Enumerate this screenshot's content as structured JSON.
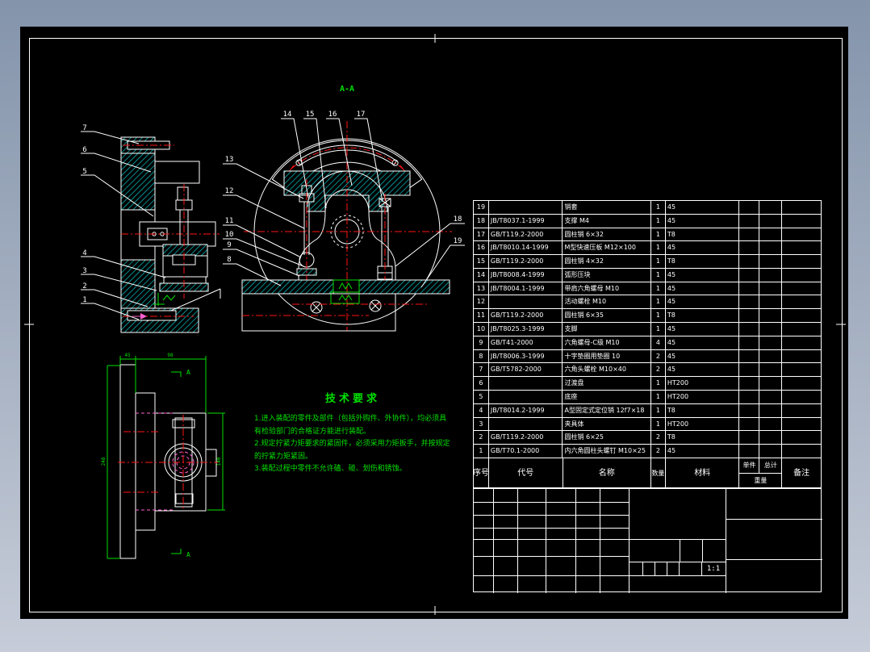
{
  "colors": {
    "background_top": "#8494ab",
    "background_bottom": "#c6ccd8",
    "canvas": "#000000",
    "line": "#ffffff",
    "hatch": "#00e6e6",
    "centerline": "#ff1414",
    "annotation": "#00e000",
    "hidden_line": "#ff5fd0"
  },
  "section_view": {
    "title": "A-A",
    "labels_top": [
      "14",
      "15",
      "16",
      "17"
    ],
    "labels_left": [
      "13",
      "12",
      "11",
      "10",
      "9",
      "8"
    ],
    "labels_right": [
      "18",
      "19"
    ]
  },
  "side_view": {
    "labels_upper": [
      "7",
      "6",
      "5"
    ],
    "labels_lower": [
      "4",
      "3",
      "2",
      "1"
    ]
  },
  "front_view": {
    "section_letter": "A",
    "dims": {
      "top_left": "45",
      "top_right": "98",
      "left": "248",
      "right": "140"
    }
  },
  "tech_requirements": {
    "title": "技术要求",
    "items": [
      "1.进入装配的零件及部件（包括外购件、外协件），均必须具有检验部门的合格证方能进行装配。",
      "2.规定拧紧力矩要求的紧固件，必须采用力矩扳手，并按规定的拧紧力矩紧固。",
      "3.装配过程中零件不允许磕、碰、划伤和锈蚀。"
    ]
  },
  "parts_table": {
    "headers": {
      "no": "序号",
      "code": "代号",
      "name": "名称",
      "qty": "数量",
      "material": "材料",
      "unit": "单件",
      "total": "总计",
      "weight": "重量",
      "remark": "备注"
    },
    "rows": [
      {
        "no": "19",
        "code": "",
        "name": "销套",
        "qty": "1",
        "material": "45"
      },
      {
        "no": "18",
        "code": "JB/T8037.1-1999",
        "name": "支撑 M4",
        "qty": "1",
        "material": "45"
      },
      {
        "no": "17",
        "code": "GB/T119.2-2000",
        "name": "圆柱销 6×32",
        "qty": "1",
        "material": "T8"
      },
      {
        "no": "16",
        "code": "JB/T8010.14-1999",
        "name": "M型快速压板 M12×100",
        "qty": "1",
        "material": "45"
      },
      {
        "no": "15",
        "code": "GB/T119.2-2000",
        "name": "圆柱销 4×32",
        "qty": "1",
        "material": "T8"
      },
      {
        "no": "14",
        "code": "JB/T8008.4-1999",
        "name": "弧形压块",
        "qty": "1",
        "material": "45"
      },
      {
        "no": "13",
        "code": "JB/T8004.1-1999",
        "name": "带肩六角螺母 M10",
        "qty": "1",
        "material": "45"
      },
      {
        "no": "12",
        "code": "",
        "name": "活动螺栓 M10",
        "qty": "1",
        "material": "45"
      },
      {
        "no": "11",
        "code": "GB/T119.2-2000",
        "name": "圆柱销 6×35",
        "qty": "1",
        "material": "T8"
      },
      {
        "no": "10",
        "code": "JB/T8025.3-1999",
        "name": "支脚",
        "qty": "1",
        "material": "45"
      },
      {
        "no": "9",
        "code": "GB/T41-2000",
        "name": "六角螺母-C级 M10",
        "qty": "4",
        "material": "45"
      },
      {
        "no": "8",
        "code": "JB/T8006.3-1999",
        "name": "十字垫圈用垫圈 10",
        "qty": "2",
        "material": "45"
      },
      {
        "no": "7",
        "code": "GB/T5782-2000",
        "name": "六角头螺栓 M10×40",
        "qty": "2",
        "material": "45"
      },
      {
        "no": "6",
        "code": "",
        "name": "过渡盘",
        "qty": "1",
        "material": "HT200"
      },
      {
        "no": "5",
        "code": "",
        "name": "底座",
        "qty": "1",
        "material": "HT200"
      },
      {
        "no": "4",
        "code": "JB/T8014.2-1999",
        "name": "A型固定式定位销 12f7×18",
        "qty": "1",
        "material": "T8"
      },
      {
        "no": "3",
        "code": "",
        "name": "夹具体",
        "qty": "1",
        "material": "HT200"
      },
      {
        "no": "2",
        "code": "GB/T119.2-2000",
        "name": "圆柱销 6×25",
        "qty": "2",
        "material": "T8"
      },
      {
        "no": "1",
        "code": "GB/T70.1-2000",
        "name": "内六角圆柱头螺钉 M10×25",
        "qty": "2",
        "material": "45"
      }
    ]
  },
  "title_block": {
    "scale": "1:1"
  }
}
